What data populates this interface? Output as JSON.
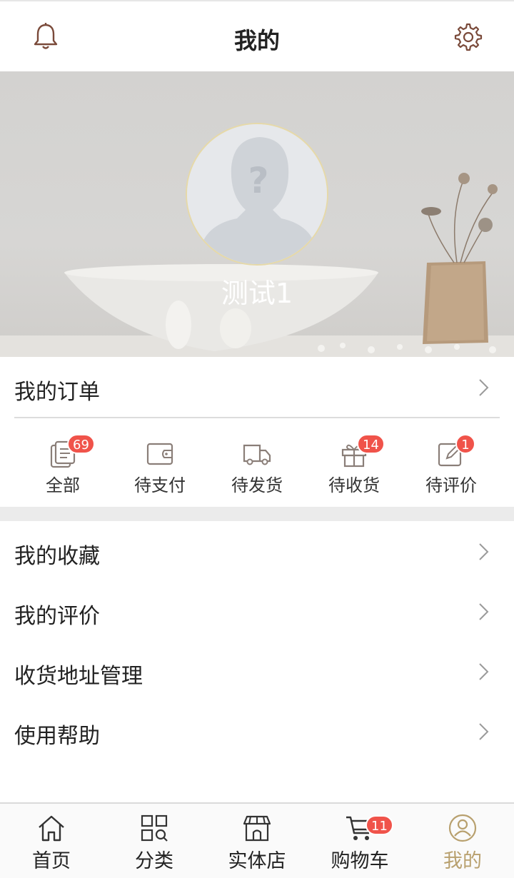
{
  "header": {
    "title": "我的",
    "left_icon": "bell-icon",
    "right_icon": "gear-icon"
  },
  "profile": {
    "username": "测试1",
    "avatar_icon": "default-avatar-icon"
  },
  "orders": {
    "title": "我的订单",
    "statuses": [
      {
        "label": "全部",
        "icon": "order-list-icon",
        "badge": "69"
      },
      {
        "label": "待支付",
        "icon": "wallet-icon",
        "badge": ""
      },
      {
        "label": "待发货",
        "icon": "truck-icon",
        "badge": ""
      },
      {
        "label": "待收货",
        "icon": "gift-icon",
        "badge": "14"
      },
      {
        "label": "待评价",
        "icon": "edit-icon",
        "badge": "1"
      }
    ]
  },
  "menu": [
    {
      "label": "我的收藏"
    },
    {
      "label": "我的评价"
    },
    {
      "label": "收货地址管理"
    },
    {
      "label": "使用帮助"
    }
  ],
  "tabbar": [
    {
      "label": "首页",
      "icon": "home-icon",
      "badge": "",
      "active": false
    },
    {
      "label": "分类",
      "icon": "category-icon",
      "badge": "",
      "active": false
    },
    {
      "label": "实体店",
      "icon": "store-icon",
      "badge": "",
      "active": false
    },
    {
      "label": "购物车",
      "icon": "cart-icon",
      "badge": "11",
      "active": false
    },
    {
      "label": "我的",
      "icon": "profile-icon",
      "badge": "",
      "active": true
    }
  ],
  "colors": {
    "accent": "#b8a06e",
    "badge": "#f0534a",
    "icon_brown": "#7a5a48"
  }
}
